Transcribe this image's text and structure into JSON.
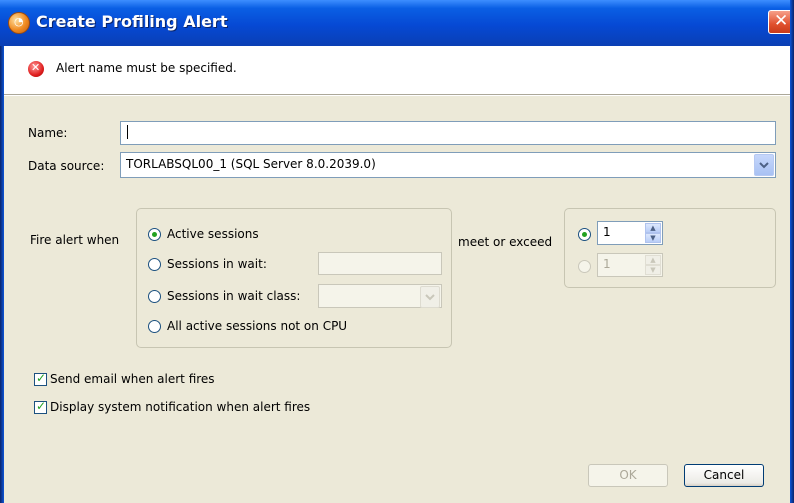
{
  "window": {
    "title": "Create Profiling Alert",
    "close_glyph": "✕"
  },
  "message": {
    "icon": "error-icon",
    "text": "Alert name must be specified."
  },
  "form": {
    "name_label": "Name:",
    "name_value": "",
    "datasource_label": "Data source:",
    "datasource_value": "TORLABSQL00_1 (SQL Server 8.0.2039.0)"
  },
  "fire_alert": {
    "label": "Fire alert when",
    "options": [
      {
        "label": "Active sessions",
        "selected": true
      },
      {
        "label": "Sessions in wait:",
        "selected": false
      },
      {
        "label": "Sessions in wait class:",
        "selected": false
      },
      {
        "label": "All active sessions not on CPU",
        "selected": false
      }
    ],
    "wait_value": "",
    "wait_class_value": ""
  },
  "threshold": {
    "label": "meet or exceed",
    "value1": "1",
    "value1_selected": true,
    "value2": "1",
    "value2_enabled": false
  },
  "notifications": {
    "email_label": "Send email when alert fires",
    "email_checked": true,
    "system_label": "Display system notification when alert fires",
    "system_checked": true
  },
  "buttons": {
    "ok": "OK",
    "ok_enabled": false,
    "cancel": "Cancel"
  },
  "colors": {
    "titlebar": "#0a5fe4",
    "window_bg": "#ece9d8",
    "check_green": "#21a121",
    "error_red": "#e02020"
  }
}
